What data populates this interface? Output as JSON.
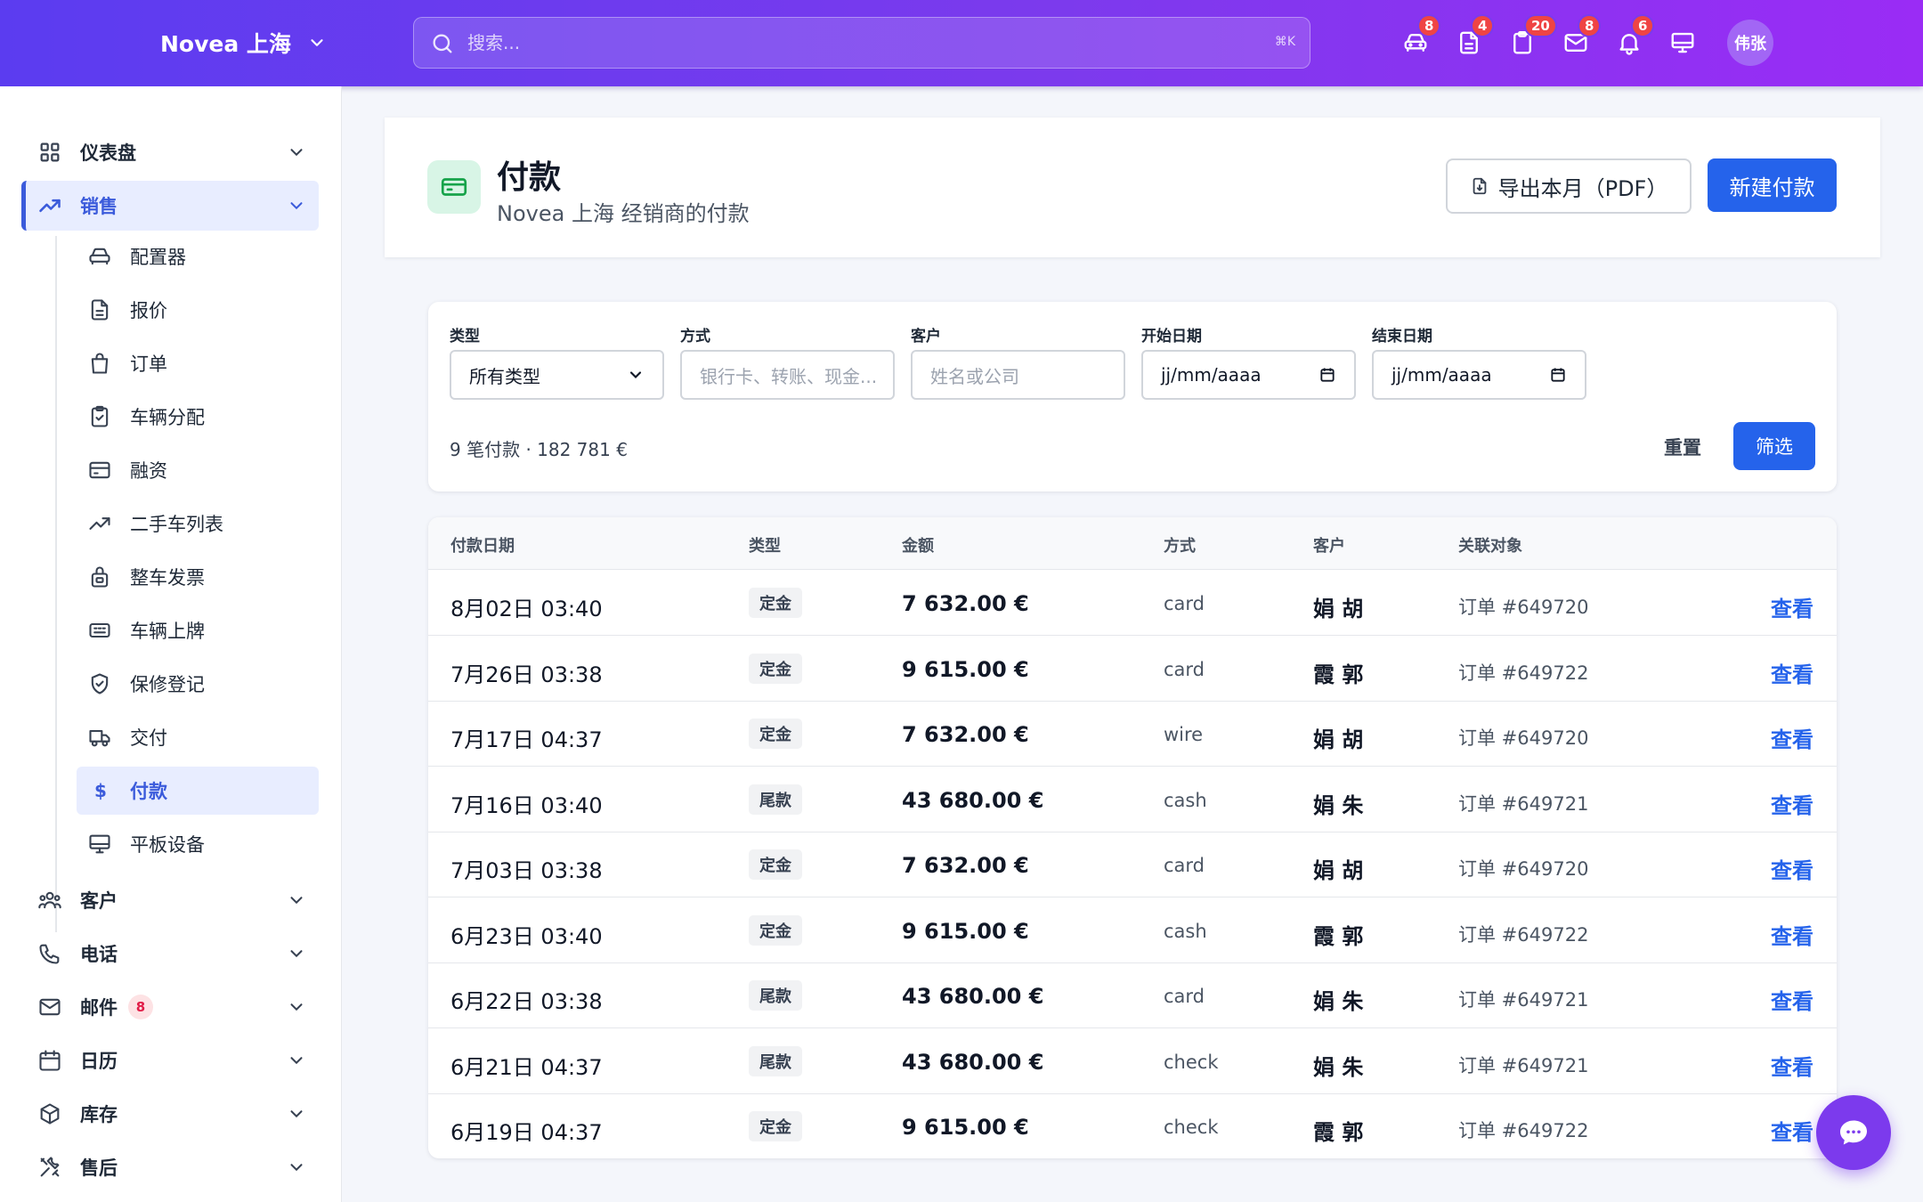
{
  "topbar": {
    "brand": "Novea 上海",
    "search_placeholder": "搜索...",
    "search_shortcut": "⌘K",
    "icons": [
      {
        "name": "car-icon",
        "badge": "8"
      },
      {
        "name": "document-icon",
        "badge": "4"
      },
      {
        "name": "clipboard-icon",
        "badge": "20"
      },
      {
        "name": "mail-icon",
        "badge": "8"
      },
      {
        "name": "bell-icon",
        "badge": "6"
      },
      {
        "name": "monitor-icon",
        "badge": ""
      }
    ],
    "avatar": "伟张"
  },
  "sidebar": {
    "dashboard": "仪表盘",
    "sales": "销售",
    "sub": {
      "configurator": "配置器",
      "quotes": "报价",
      "orders": "订单",
      "vehicle_allocation": "车辆分配",
      "financing": "融资",
      "used_cars": "二手车列表",
      "vehicle_invoice": "整车发票",
      "registration": "车辆上牌",
      "warranty": "保修登记",
      "delivery": "交付",
      "payments": "付款",
      "payments_symbol": "$",
      "tablets": "平板设备"
    },
    "customers": "客户",
    "phone": "电话",
    "mail": "邮件",
    "mail_badge": "8",
    "calendar": "日历",
    "inventory": "库存",
    "after_sales": "售后"
  },
  "page": {
    "title": "付款",
    "subtitle": "Novea 上海 经销商的付款",
    "export_label": "导出本月（PDF）",
    "new_label": "新建付款"
  },
  "filters": {
    "type_label": "类型",
    "type_value": "所有类型",
    "method_label": "方式",
    "method_placeholder": "银行卡、转账、现金...",
    "customer_label": "客户",
    "customer_placeholder": "姓名或公司",
    "start_label": "开始日期",
    "start_value": "jj/mm/aaaa",
    "end_label": "结束日期",
    "end_value": "jj/mm/aaaa",
    "summary": "9 笔付款 · 182 781 €",
    "reset": "重置",
    "apply": "筛选"
  },
  "table": {
    "headers": [
      "付款日期",
      "类型",
      "金额",
      "方式",
      "客户",
      "关联对象"
    ],
    "view_label": "查看",
    "rows": [
      {
        "date": "8月02日 03:40",
        "type": "定金",
        "amount": "7 632.00 €",
        "method": "card",
        "customer": "娟 胡",
        "ref": "订单 #649720"
      },
      {
        "date": "7月26日 03:38",
        "type": "定金",
        "amount": "9 615.00 €",
        "method": "card",
        "customer": "霞 郭",
        "ref": "订单 #649722"
      },
      {
        "date": "7月17日 04:37",
        "type": "定金",
        "amount": "7 632.00 €",
        "method": "wire",
        "customer": "娟 胡",
        "ref": "订单 #649720"
      },
      {
        "date": "7月16日 03:40",
        "type": "尾款",
        "amount": "43 680.00 €",
        "method": "cash",
        "customer": "娟 朱",
        "ref": "订单 #649721"
      },
      {
        "date": "7月03日 03:38",
        "type": "定金",
        "amount": "7 632.00 €",
        "method": "card",
        "customer": "娟 胡",
        "ref": "订单 #649720"
      },
      {
        "date": "6月23日 03:40",
        "type": "定金",
        "amount": "9 615.00 €",
        "method": "cash",
        "customer": "霞 郭",
        "ref": "订单 #649722"
      },
      {
        "date": "6月22日 03:38",
        "type": "尾款",
        "amount": "43 680.00 €",
        "method": "card",
        "customer": "娟 朱",
        "ref": "订单 #649721"
      },
      {
        "date": "6月21日 04:37",
        "type": "尾款",
        "amount": "43 680.00 €",
        "method": "check",
        "customer": "娟 朱",
        "ref": "订单 #649721"
      },
      {
        "date": "6月19日 04:37",
        "type": "定金",
        "amount": "9 615.00 €",
        "method": "check",
        "customer": "霞 郭",
        "ref": "订单 #649722"
      }
    ]
  },
  "colors": {
    "topbar_start": "#5b3cf0",
    "topbar_end": "#9a2cf5",
    "primary": "#2563eb",
    "active_nav": "#3b5bdb",
    "badge": "#ef4444"
  }
}
